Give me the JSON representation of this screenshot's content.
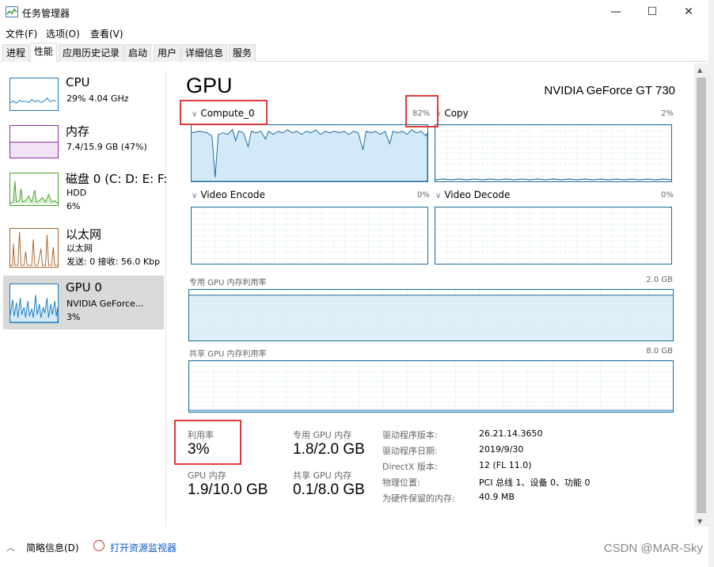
{
  "window": {
    "title": "任务管理器",
    "minimize": "—",
    "maximize": "☐",
    "close": "✕"
  },
  "menu": [
    "文件(F)",
    "选项(O)",
    "查看(V)"
  ],
  "tabs": [
    "进程",
    "性能",
    "应用历史记录",
    "启动",
    "用户",
    "详细信息",
    "服务"
  ],
  "sidebar": {
    "items": [
      {
        "name": "CPU",
        "sub1": "29%  4.04 GHz",
        "sub2": "",
        "color": "#1a7cc1"
      },
      {
        "name": "内存",
        "sub1": "7.4/15.9 GB (47%)",
        "sub2": "",
        "color": "#8b2fa3"
      },
      {
        "name": "磁盘 0 (C: D: E: F:",
        "sub1": "HDD",
        "sub2": "6%",
        "color": "#4aa02c"
      },
      {
        "name": "以太网",
        "sub1": "以太网",
        "sub2": "发送: 0  接收: 56.0 Kbp",
        "color": "#a8652a"
      },
      {
        "name": "GPU 0",
        "sub1": "NVIDIA GeForce...",
        "sub2": "3%",
        "color": "#1a7cc1"
      }
    ]
  },
  "gpu": {
    "title": "GPU",
    "model": "NVIDIA GeForce GT 730",
    "engines": [
      {
        "name": "Compute_0",
        "pct": "82%"
      },
      {
        "name": "Copy",
        "pct": "2%"
      },
      {
        "name": "Video Encode",
        "pct": "0%"
      },
      {
        "name": "Video Decode",
        "pct": "0%"
      }
    ],
    "dedicated_mem": {
      "label": "专用 GPU 内存利用率",
      "max": "2.0 GB"
    },
    "shared_mem": {
      "label": "共享 GPU 内存利用率",
      "max": "8.0 GB"
    },
    "stats": {
      "util_label": "利用率",
      "util_value": "3%",
      "ded_label": "专用 GPU 内存",
      "ded_value": "1.8/2.0 GB",
      "gpu_mem_label": "GPU 内存",
      "gpu_mem_value": "1.9/10.0 GB",
      "shared_label": "共享 GPU 内存",
      "shared_value": "0.1/8.0 GB"
    },
    "details": [
      {
        "key": "驱动程序版本:",
        "val": "26.21.14.3650"
      },
      {
        "key": "驱动程序日期:",
        "val": "2019/9/30"
      },
      {
        "key": "DirectX 版本:",
        "val": "12 (FL 11.0)"
      },
      {
        "key": "物理位置:",
        "val": "PCI 总线 1、设备 0、功能 0"
      },
      {
        "key": "为硬件保留的内存:",
        "val": "40.9 MB"
      }
    ]
  },
  "bottom": {
    "summary": "简略信息(D)",
    "monitor": "打开资源监视器"
  },
  "watermark": "CSDN @MAR-Sky",
  "colors": {
    "gpu_line": "#1b6c9d",
    "gpu_fill": "#d4e9f7",
    "highlight": "#e03b3b"
  }
}
